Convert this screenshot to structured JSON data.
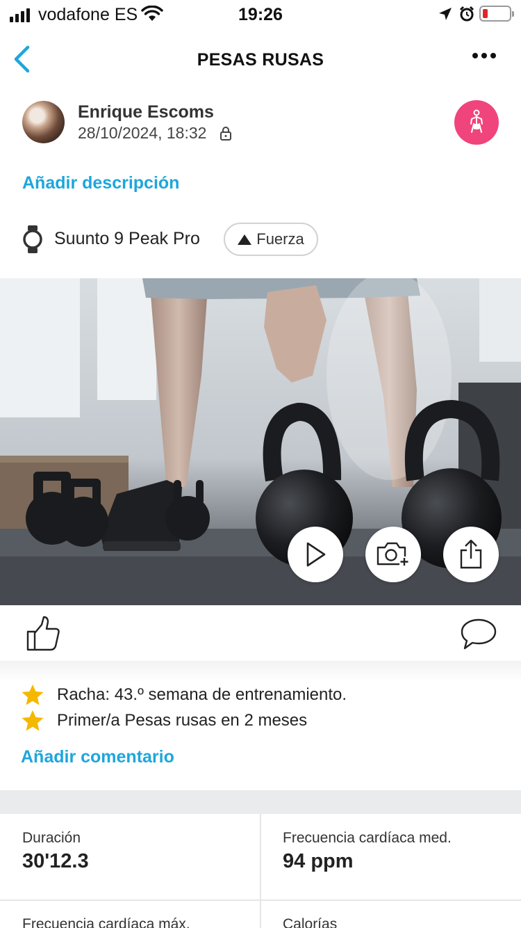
{
  "status_bar": {
    "carrier": "vodafone ES",
    "time": "19:26"
  },
  "nav": {
    "title": "PESAS RUSAS"
  },
  "user": {
    "name": "Enrique Escoms",
    "date": "28/10/2024, 18:32"
  },
  "add_description": "Añadir descripción",
  "device": {
    "name": "Suunto 9 Peak Pro",
    "tag": "Fuerza"
  },
  "achievements": [
    "Racha: 43.º semana de entrenamiento.",
    "Primer/a Pesas rusas en 2 meses"
  ],
  "add_comment": "Añadir comentario",
  "stats": [
    {
      "label": "Duración",
      "value": "30'12.3"
    },
    {
      "label": "Frecuencia cardíaca med.",
      "value": "94 ppm"
    },
    {
      "label": "Frecuencia cardíaca máx.",
      "value": ""
    },
    {
      "label": "Calorías",
      "value": ""
    }
  ],
  "colors": {
    "accent": "#1ea6dc",
    "activity_badge": "#f0447c",
    "star": "#f5b800",
    "battery_low": "#e0262a"
  },
  "icons": [
    "back-chevron-icon",
    "more-icon",
    "lock-icon",
    "strength-icon",
    "watch-icon",
    "play-icon",
    "camera-add-icon",
    "share-icon",
    "like-icon",
    "comment-icon",
    "star-icon"
  ]
}
